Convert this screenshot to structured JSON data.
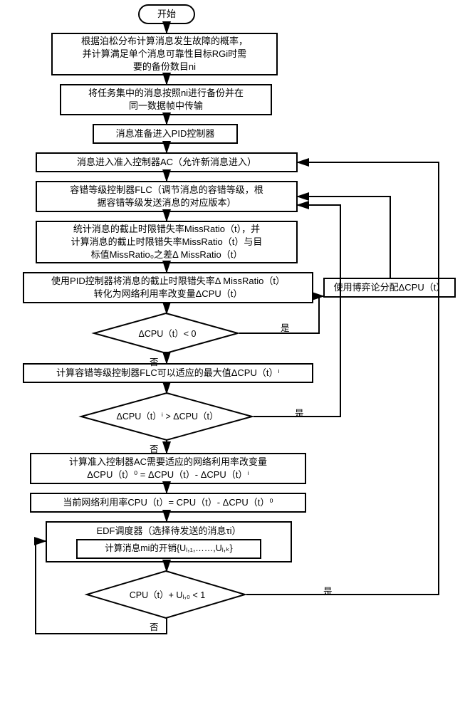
{
  "terminator_start": "开始",
  "box_poisson": "根据泊松分布计算消息发生故障的概率，\n并计算满足单个消息可靠性目标RGi时需\n要的备份数目ni",
  "box_backup": "将任务集中的消息按照ni进行备份并在\n同一数据帧中传输",
  "box_prepare_pid": "消息准备进入PID控制器",
  "box_ac": "消息进入准入控制器AC（允许新消息进入）",
  "box_flc": "容错等级控制器FLC（调节消息的容错等级，根\n据容错等级发送消息的对应版本）",
  "box_missratio_stat": "统计消息的截止时限错失率MissRatio（t），并\n计算消息的截止时限错失率MissRatio（t）与目\n标值MissRatio₀之差Δ MissRatio（t）",
  "box_pid_convert": "使用PID控制器将消息的截止时限错失率Δ MissRatio（t）\n转化为网络利用率改变量ΔCPU（t）",
  "box_gametheory": "使用博弈论分配ΔCPU（t）",
  "diamond_cpu_neg": "ΔCPU（t）< 0",
  "box_flc_max": "计算容错等级控制器FLC可以适应的最大值ΔCPU（t）ⁱ",
  "diamond_cpu_cmp": "ΔCPU（t）ⁱ > ΔCPU（t）",
  "box_ac_adapt": "计算准入控制器AC需要适应的网络利用率改变量\nΔCPU（t）⁰ = ΔCPU（t）- ΔCPU（t）ⁱ",
  "box_cur_cpu": "当前网络利用率CPU（t）= CPU（t）- ΔCPU（t）⁰",
  "box_edf_outer": "EDF调度器（选择待发送的消息τi）",
  "box_edf_inner": "计算消息mi的开销{Uᵢ,₁,……,Uᵢ,ₖ}",
  "diamond_cpu_sum": "CPU（t）+ Uᵢ,₀ < 1",
  "label_yes": "是",
  "label_no": "否",
  "chart_data": {
    "type": "flowchart",
    "nodes": [
      {
        "id": "start",
        "type": "terminator",
        "label": "开始"
      },
      {
        "id": "poisson",
        "type": "process",
        "label": "根据泊松分布计算消息发生故障的概率，并计算满足单个消息可靠性目标RGi时需要的备份数目ni"
      },
      {
        "id": "backup",
        "type": "process",
        "label": "将任务集中的消息按照ni进行备份并在同一数据帧中传输"
      },
      {
        "id": "prepare_pid",
        "type": "process",
        "label": "消息准备进入PID控制器"
      },
      {
        "id": "ac",
        "type": "process",
        "label": "消息进入准入控制器AC（允许新消息进入）"
      },
      {
        "id": "flc",
        "type": "process",
        "label": "容错等级控制器FLC（调节消息的容错等级，根据容错等级发送消息的对应版本）"
      },
      {
        "id": "missratio",
        "type": "process",
        "label": "统计消息的截止时限错失率MissRatio（t），并计算消息的截止时限错失率MissRatio（t）与目标值MissRatio₀之差Δ MissRatio（t）"
      },
      {
        "id": "pidconv",
        "type": "process",
        "label": "使用PID控制器将消息的截止时限错失率Δ MissRatio（t）转化为网络利用率改变量ΔCPU（t）"
      },
      {
        "id": "d1",
        "type": "decision",
        "label": "ΔCPU（t）< 0"
      },
      {
        "id": "flcmax",
        "type": "process",
        "label": "计算容错等级控制器FLC可以适应的最大值ΔCPU（t）ⁱ"
      },
      {
        "id": "d2",
        "type": "decision",
        "label": "ΔCPU（t）ⁱ > ΔCPU（t）"
      },
      {
        "id": "acadapt",
        "type": "process",
        "label": "计算准入控制器AC需要适应的网络利用率改变量 ΔCPU（t）⁰ = ΔCPU（t）- ΔCPU（t）ⁱ"
      },
      {
        "id": "curcpu",
        "type": "process",
        "label": "当前网络利用率CPU（t）= CPU（t）- ΔCPU（t）⁰"
      },
      {
        "id": "edf",
        "type": "process",
        "label": "EDF调度器（选择待发送的消息τi）",
        "inner": "计算消息mi的开销{Uᵢ,₁,……,Uᵢ,ₖ}"
      },
      {
        "id": "d3",
        "type": "decision",
        "label": "CPU（t）+ Uᵢ,₀ < 1"
      },
      {
        "id": "gametheory",
        "type": "process",
        "label": "使用博弈论分配ΔCPU（t）"
      }
    ],
    "edges": [
      {
        "from": "start",
        "to": "poisson"
      },
      {
        "from": "poisson",
        "to": "backup"
      },
      {
        "from": "backup",
        "to": "prepare_pid"
      },
      {
        "from": "prepare_pid",
        "to": "ac"
      },
      {
        "from": "ac",
        "to": "flc"
      },
      {
        "from": "flc",
        "to": "missratio"
      },
      {
        "from": "missratio",
        "to": "pidconv"
      },
      {
        "from": "pidconv",
        "to": "d1"
      },
      {
        "from": "d1",
        "to": "gametheory",
        "label": "是"
      },
      {
        "from": "d1",
        "to": "flcmax",
        "label": "否"
      },
      {
        "from": "flcmax",
        "to": "d2"
      },
      {
        "from": "d2",
        "to": "flc",
        "label": "是"
      },
      {
        "from": "d2",
        "to": "acadapt",
        "label": "否"
      },
      {
        "from": "acadapt",
        "to": "curcpu"
      },
      {
        "from": "curcpu",
        "to": "edf"
      },
      {
        "from": "edf",
        "to": "d3"
      },
      {
        "from": "d3",
        "to": "ac",
        "label": "是"
      },
      {
        "from": "d3",
        "to": "edf",
        "label": "否"
      },
      {
        "from": "gametheory",
        "to": "flc"
      }
    ]
  }
}
